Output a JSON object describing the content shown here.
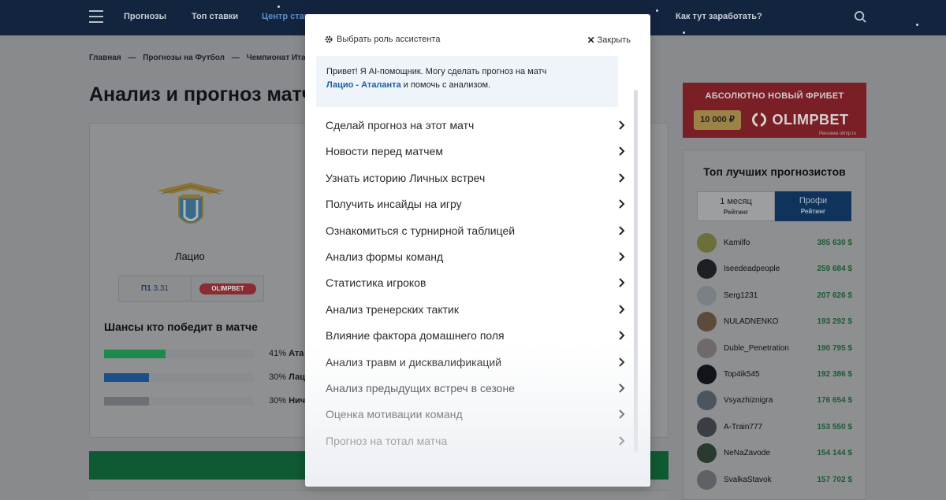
{
  "nav": {
    "items": [
      "Прогнозы",
      "Топ ставки",
      "Центр ставок",
      "Как тут заработать?"
    ]
  },
  "breadcrumbs": [
    "Главная",
    "—",
    "Прогнозы на Футбол",
    "—",
    "Чемпионат Италии"
  ],
  "page": {
    "title": "Анализ и прогноз матча"
  },
  "match": {
    "team1": "Лацио",
    "odds_label": "П1",
    "odds_value": "3.31",
    "bookmaker": "OLIMPBET"
  },
  "chances": {
    "title": "Шансы кто победит в матче",
    "rows": [
      {
        "percent": "41%",
        "team": "Ата",
        "value": 0.41,
        "color": "#1d8a4d"
      },
      {
        "percent": "30%",
        "team": "Лац",
        "value": 0.3,
        "color": "#1f4f8a"
      },
      {
        "percent": "30%",
        "team": "Нич",
        "value": 0.3,
        "color": "#6c6f73"
      }
    ]
  },
  "promo": {
    "title": "АБСОЛЮТНО НОВЫЙ ФРИБЕТ",
    "amount": "10 000 ₽",
    "brand": "OLIMPBET",
    "note": "Реклама olimp.ru"
  },
  "top_forecasters": {
    "title": "Топ лучших прогнозистов",
    "tabs": [
      {
        "label": "1 месяц",
        "sub": "Рейтинг"
      },
      {
        "label": "Профи",
        "sub": "Рейтинг"
      }
    ],
    "users": [
      {
        "name": "Kamilfo",
        "score": "385 630 $"
      },
      {
        "name": "Iseedeadpeople",
        "score": "259 684 $"
      },
      {
        "name": "Serg1231",
        "score": "207 626 $"
      },
      {
        "name": "NULADNENKO",
        "score": "193 292 $"
      },
      {
        "name": "Duble_Penetration",
        "score": "190 795 $"
      },
      {
        "name": "Top4ik545",
        "score": "192 386 $"
      },
      {
        "name": "Vsyazhiznigra",
        "score": "176 654 $"
      },
      {
        "name": "A-Train777",
        "score": "153 550 $"
      },
      {
        "name": "NeNaZavode",
        "score": "154 144 $"
      },
      {
        "name": "SvalkaStavok",
        "score": "157 702 $"
      }
    ]
  },
  "modal": {
    "role_label": "Выбрать роль ассистента",
    "close_label": "Закрыть",
    "greeting_text": "Привет! Я AI-помощник. Могу сделать прогноз на матч",
    "greeting_match": "Лацио - Аталанта",
    "greeting_tail": " и помочь с анализом.",
    "menu": [
      "Сделай прогноз на этот матч",
      "Новости перед матчем",
      "Узнать историю Личных встреч",
      "Получить инсайды на игру",
      "Ознакомиться с турнирной таблицей",
      "Анализ формы команд",
      "Статистика игроков",
      "Анализ тренерских тактик",
      "Влияние фактора домашнего поля",
      "Анализ травм и дисквалификаций",
      "Анализ предыдущих встреч в сезоне",
      "Оценка мотивации команд",
      "Прогноз на тотал матча"
    ]
  }
}
